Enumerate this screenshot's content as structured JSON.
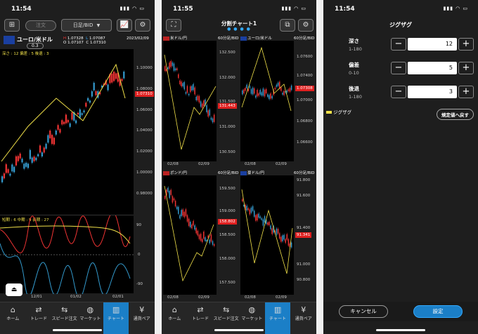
{
  "status": {
    "p1_time": "11:54",
    "p2_time": "11:55",
    "p3_time": "11:54"
  },
  "tabs": [
    {
      "label": "ホーム",
      "icon": "home-icon"
    },
    {
      "label": "トレード",
      "icon": "trade-icon"
    },
    {
      "label": "スピード注文",
      "icon": "speed-order-icon"
    },
    {
      "label": "マーケット",
      "icon": "market-icon"
    },
    {
      "label": "チャート",
      "icon": "chart-icon"
    },
    {
      "label": "通貨ペア",
      "icon": "currency-pair-icon"
    }
  ],
  "p1": {
    "order_btn": "注文",
    "timeframe": "日足/BID",
    "pair": "ユーロ/米ドル",
    "lot": "0.3",
    "ohlc": {
      "h_label": "H",
      "h": "1.07328",
      "l_label": "L",
      "l": "1.07087",
      "o_label": "O",
      "o": "1.07107",
      "c_label": "C",
      "c": "1.07310"
    },
    "date": "2023/02/09",
    "zigzag_params": "深さ : 12 偏差 : 5 後退 : 3",
    "yticks": [
      "1.10000",
      "1.08000",
      "1.06000",
      "1.04000",
      "1.02000",
      "1.00000",
      "0.98000"
    ],
    "last_price": "1.07310",
    "osc_label": "短期 : 6 中期 : 9 長期 : 27",
    "osc_ticks": [
      "90",
      "0",
      "-90"
    ],
    "xticks": [
      "12/01",
      "01/02",
      "02/01"
    ]
  },
  "p2": {
    "title": "分割チャート1",
    "charts": [
      {
        "pair": "米ドル/円",
        "tf": "60分足/BID",
        "yticks": [
          "132.500",
          "132.000",
          "131.500",
          "131.000",
          "130.500"
        ],
        "price": "131.443",
        "xticks": [
          "02/08",
          "02/09"
        ]
      },
      {
        "pair": "ユーロ/米ドル",
        "tf": "60分足/BID",
        "yticks": [
          "1.07600",
          "1.07400",
          "1.07000",
          "1.06800",
          "1.06600"
        ],
        "price": "1.07308",
        "xticks": [
          "02/08",
          "02/09"
        ]
      },
      {
        "pair": "ポンド/円",
        "tf": "60分足/BID",
        "yticks": [
          "159.500",
          "159.000",
          "158.500",
          "158.000",
          "157.500"
        ],
        "price": "158.802",
        "xticks": [
          "02/08",
          "02/09"
        ]
      },
      {
        "pair": "豪ドル/円",
        "tf": "60分足/BID",
        "yticks": [
          "91.800",
          "91.600",
          "91.400",
          "91.000",
          "90.800"
        ],
        "price": "91.341",
        "xticks": [
          "02/08",
          "02/09"
        ]
      }
    ]
  },
  "p3": {
    "title": "ジグザグ",
    "params": [
      {
        "label": "深さ",
        "range": "1-180",
        "value": "12"
      },
      {
        "label": "偏差",
        "range": "0-10",
        "value": "5"
      },
      {
        "label": "後退",
        "range": "1-180",
        "value": "3"
      }
    ],
    "legend": "ジグザグ",
    "reset_btn": "規定値へ戻す",
    "cancel_btn": "キャンセル",
    "ok_btn": "設定",
    "minus": "−",
    "plus": "+"
  }
}
